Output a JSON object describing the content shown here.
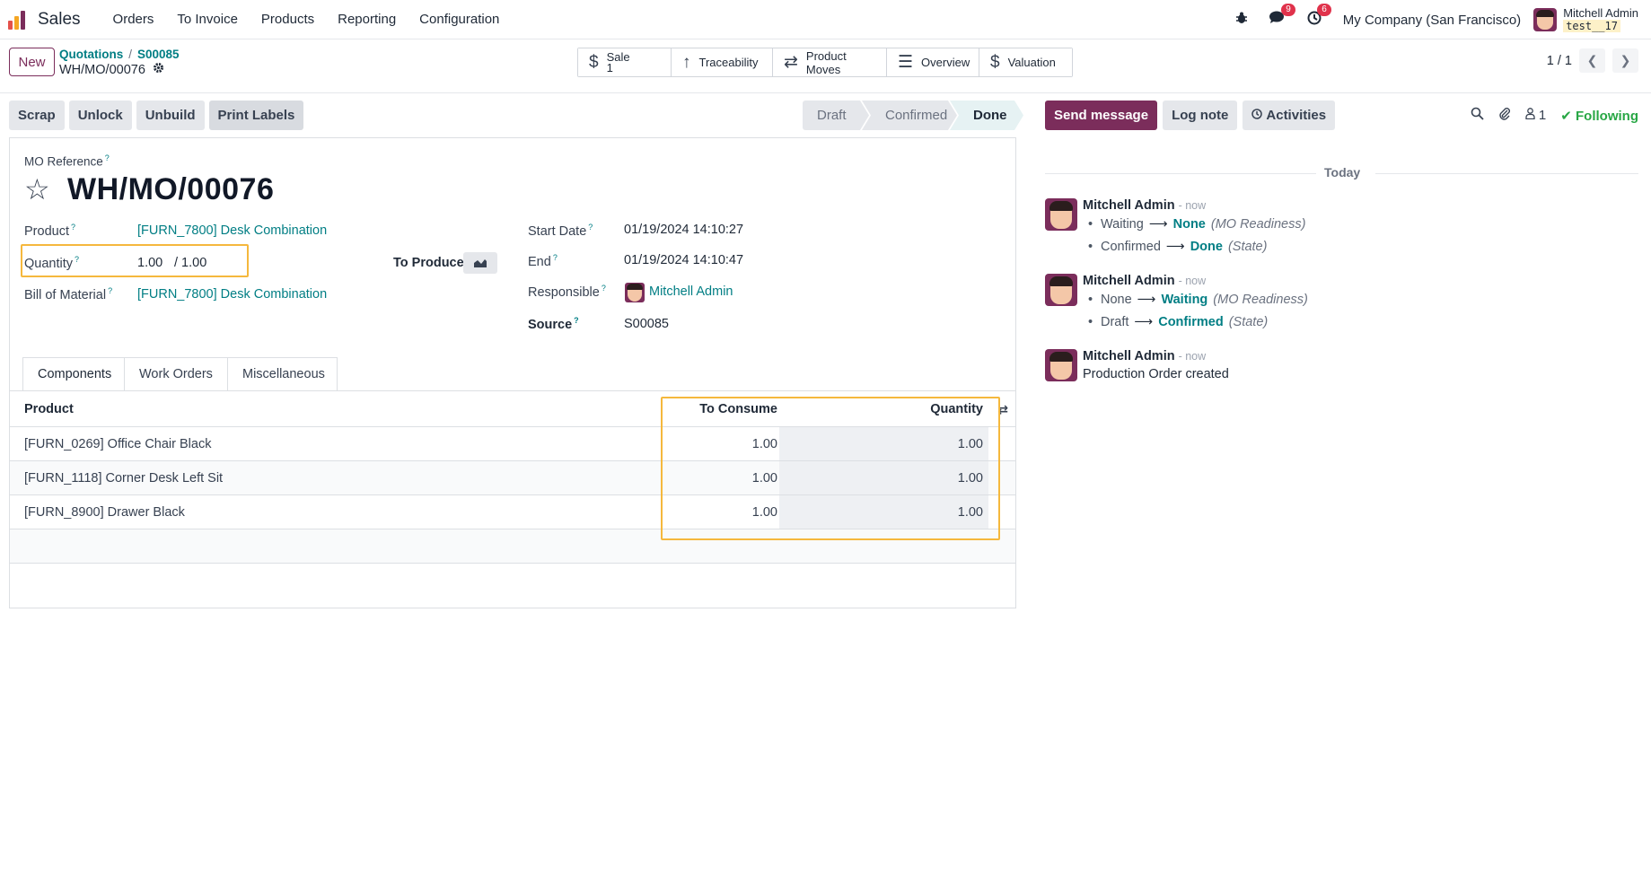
{
  "topnav": {
    "app_name": "Sales",
    "menu": [
      "Orders",
      "To Invoice",
      "Products",
      "Reporting",
      "Configuration"
    ],
    "chat_badge": "9",
    "activity_badge": "6",
    "company": "My Company (San Francisco)",
    "user_name": "Mitchell Admin",
    "db_name": "test__17"
  },
  "control": {
    "new_label": "New",
    "breadcrumb": [
      "Quotations",
      "S00085"
    ],
    "record_name": "WH/MO/00076",
    "smart_buttons": {
      "sale_label": "Sale",
      "sale_count": "1",
      "traceability": "Traceability",
      "product_moves": "Product Moves",
      "overview": "Overview",
      "valuation": "Valuation"
    },
    "pager": "1 / 1"
  },
  "actions": [
    "Scrap",
    "Unlock",
    "Unbuild",
    "Print Labels"
  ],
  "status": {
    "stages": [
      "Draft",
      "Confirmed",
      "Done"
    ],
    "active": "Done"
  },
  "form": {
    "mo_reference_label": "MO Reference",
    "mo_reference": "WH/MO/00076",
    "product_label": "Product",
    "product": "[FURN_7800] Desk Combination",
    "quantity_label": "Quantity",
    "quantity": "1.00",
    "quantity_total": "/ 1.00",
    "to_produce_label": "To Produce",
    "bom_label": "Bill of Material",
    "bom": "[FURN_7800] Desk Combination",
    "start_date_label": "Start Date",
    "start_date": "01/19/2024 14:10:27",
    "end_label": "End",
    "end": "01/19/2024 14:10:47",
    "responsible_label": "Responsible",
    "responsible": "Mitchell Admin",
    "source_label": "Source",
    "source": "S00085"
  },
  "tabs": [
    "Components",
    "Work Orders",
    "Miscellaneous"
  ],
  "components": {
    "headers": {
      "product": "Product",
      "to_consume": "To Consume",
      "quantity": "Quantity"
    },
    "rows": [
      {
        "product": "[FURN_0269] Office Chair Black",
        "to_consume": "1.00",
        "quantity": "1.00"
      },
      {
        "product": "[FURN_1118] Corner Desk Left Sit",
        "to_consume": "1.00",
        "quantity": "1.00"
      },
      {
        "product": "[FURN_8900] Drawer Black",
        "to_consume": "1.00",
        "quantity": "1.00"
      }
    ]
  },
  "chatter": {
    "send_message": "Send message",
    "log_note": "Log note",
    "activities": "Activities",
    "followers_count": "1",
    "following": "Following",
    "day_separator": "Today",
    "messages": [
      {
        "author": "Mitchell Admin",
        "time": "- now",
        "tracking": [
          {
            "old": "Waiting",
            "new": "None",
            "field": "(MO Readiness)"
          },
          {
            "old": "Confirmed",
            "new": "Done",
            "field": "(State)"
          }
        ]
      },
      {
        "author": "Mitchell Admin",
        "time": "- now",
        "tracking": [
          {
            "old": "None",
            "new": "Waiting",
            "field": "(MO Readiness)"
          },
          {
            "old": "Draft",
            "new": "Confirmed",
            "field": "(State)"
          }
        ]
      },
      {
        "author": "Mitchell Admin",
        "time": "- now",
        "body": "Production Order created"
      }
    ]
  },
  "colors": {
    "brand": "#7b2d5b",
    "link": "#017e84",
    "highlight": "#f5b83d",
    "following": "#28a745"
  }
}
